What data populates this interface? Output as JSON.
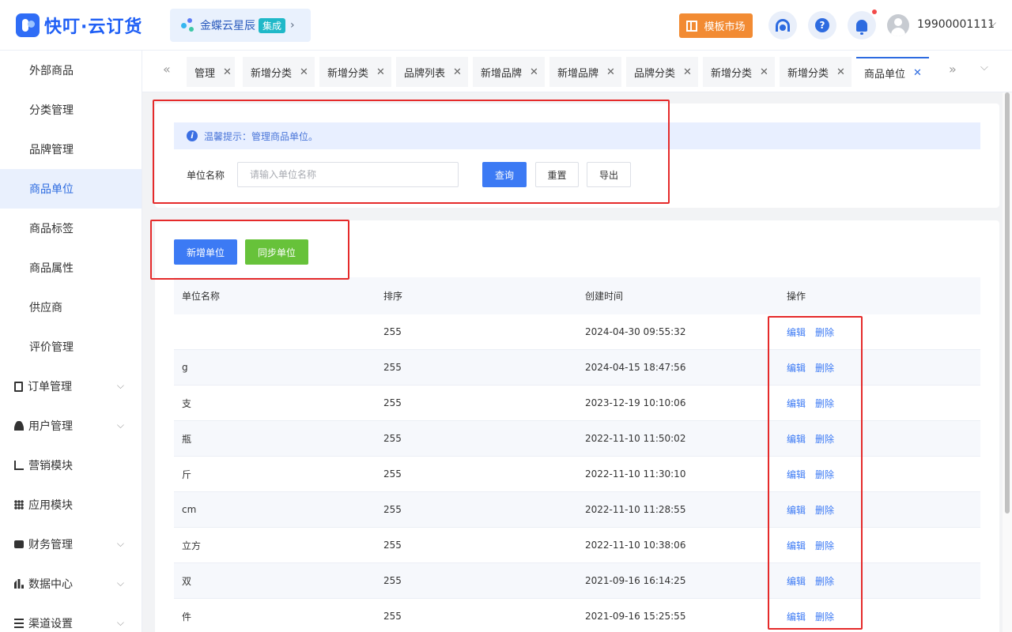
{
  "header": {
    "logo_text": "快叮·云订货",
    "integration_name": "金蝶云星辰",
    "integration_badge": "集成",
    "market_label": "模板市场",
    "help_glyph": "?",
    "username": "19900001111"
  },
  "sidebar": {
    "items": [
      {
        "label": "外部商品"
      },
      {
        "label": "分类管理"
      },
      {
        "label": "品牌管理"
      },
      {
        "label": "商品单位",
        "active": true
      },
      {
        "label": "商品标签"
      },
      {
        "label": "商品属性"
      },
      {
        "label": "供应商"
      },
      {
        "label": "评价管理"
      }
    ],
    "groups": [
      {
        "label": "订单管理",
        "icon": "document-icon"
      },
      {
        "label": "用户管理",
        "icon": "user-icon"
      },
      {
        "label": "营销模块",
        "icon": "chart-icon"
      },
      {
        "label": "应用模块",
        "icon": "apps-icon"
      },
      {
        "label": "财务管理",
        "icon": "wallet-icon"
      },
      {
        "label": "数据中心",
        "icon": "bar-chart-icon"
      },
      {
        "label": "渠道设置",
        "icon": "list-icon"
      }
    ]
  },
  "tabs": [
    {
      "label": "管理"
    },
    {
      "label": "新增分类"
    },
    {
      "label": "新增分类"
    },
    {
      "label": "品牌列表"
    },
    {
      "label": "新增品牌"
    },
    {
      "label": "新增品牌"
    },
    {
      "label": "品牌分类"
    },
    {
      "label": "新增分类"
    },
    {
      "label": "新增分类"
    },
    {
      "label": "商品单位",
      "active": true
    }
  ],
  "search": {
    "tip": "温馨提示：管理商品单位。",
    "label": "单位名称",
    "placeholder": "请输入单位名称",
    "value": "",
    "query_label": "查询",
    "reset_label": "重置",
    "export_label": "导出"
  },
  "actions": {
    "add_label": "新增单位",
    "sync_label": "同步单位"
  },
  "table": {
    "columns": [
      "单位名称",
      "排序",
      "创建时间",
      "操作"
    ],
    "edit_label": "编辑",
    "delete_label": "删除",
    "rows": [
      {
        "name": "",
        "sort": "255",
        "created": "2024-04-30 09:55:32"
      },
      {
        "name": "g",
        "sort": "255",
        "created": "2024-04-15 18:47:56"
      },
      {
        "name": "支",
        "sort": "255",
        "created": "2023-12-19 10:10:06"
      },
      {
        "name": "瓶",
        "sort": "255",
        "created": "2022-11-10 11:50:02"
      },
      {
        "name": "斤",
        "sort": "255",
        "created": "2022-11-10 11:30:10"
      },
      {
        "name": "cm",
        "sort": "255",
        "created": "2022-11-10 11:28:55"
      },
      {
        "name": "立方",
        "sort": "255",
        "created": "2022-11-10 10:38:06"
      },
      {
        "name": "双",
        "sort": "255",
        "created": "2021-09-16 16:14:25"
      },
      {
        "name": "件",
        "sort": "255",
        "created": "2021-09-16 15:25:55"
      }
    ]
  },
  "colors": {
    "primary": "#3c7af4",
    "success": "#67c23a",
    "accent_orange": "#f28b33",
    "annotation_red": "#e52a2a"
  }
}
